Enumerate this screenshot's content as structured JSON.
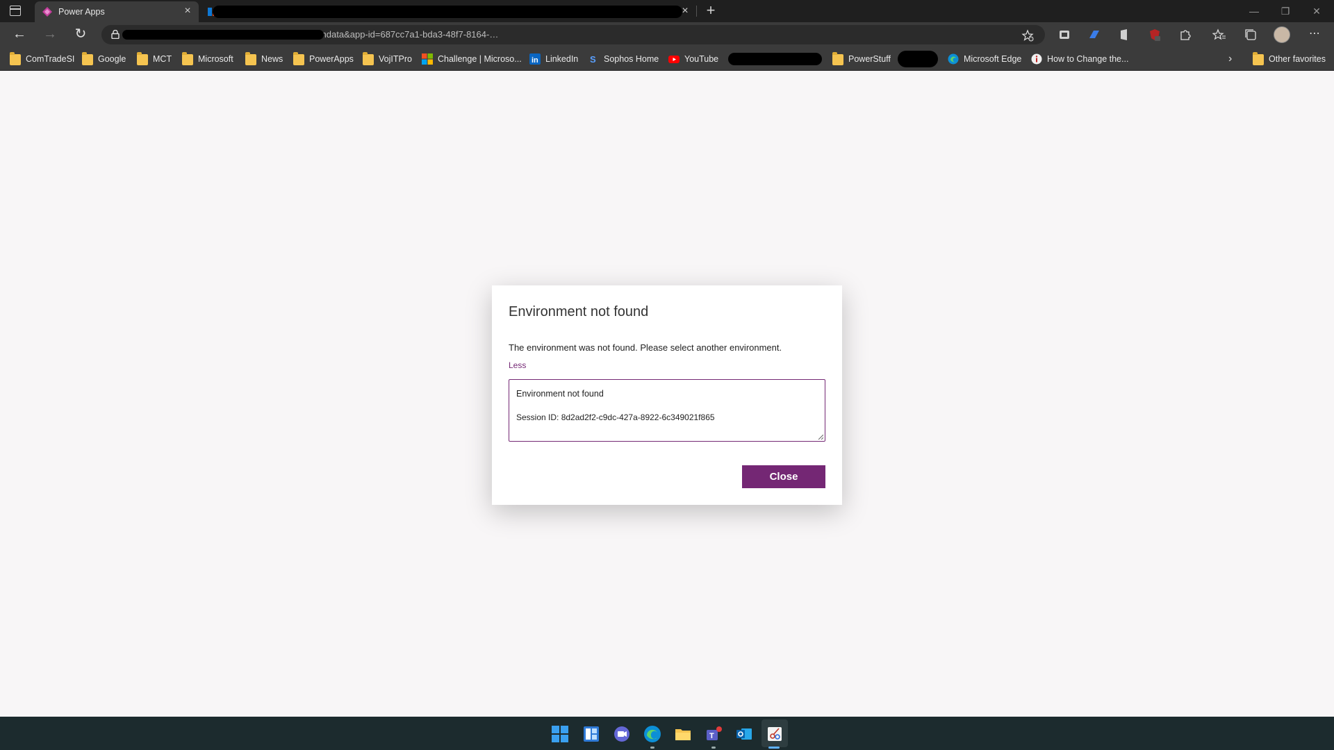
{
  "browser": {
    "tabs": [
      {
        "title": "Power Apps",
        "active": true
      },
      {
        "title": "",
        "active": false
      }
    ],
    "url": "…/studio/#action=sp-edit-formdata&app-id=687cc7a1-bda3-48f7-8164-…",
    "favorites": [
      {
        "label": "ComTradeSI",
        "icon": "folder-icon"
      },
      {
        "label": "Google",
        "icon": "folder-icon"
      },
      {
        "label": "MCT",
        "icon": "folder-icon"
      },
      {
        "label": "Microsoft",
        "icon": "folder-icon"
      },
      {
        "label": "News",
        "icon": "folder-icon"
      },
      {
        "label": "PowerApps",
        "icon": "folder-icon"
      },
      {
        "label": "VojITPro",
        "icon": "folder-icon"
      },
      {
        "label": "Challenge | Microso...",
        "icon": "microsoft-logo-icon"
      },
      {
        "label": "LinkedIn",
        "icon": "linkedin-icon"
      },
      {
        "label": "Sophos Home",
        "icon": "sophos-icon"
      },
      {
        "label": "YouTube",
        "icon": "youtube-icon"
      },
      {
        "label": "PowerStuff",
        "icon": "folder-icon"
      },
      {
        "label": "Microsoft Edge",
        "icon": "edge-icon"
      },
      {
        "label": "How to Change the...",
        "icon": "info-icon"
      }
    ],
    "other_favorites": "Other favorites",
    "colors": {
      "accent": "#742774",
      "chrome_dark": "#3b3b3b",
      "tabbar": "#1f1f1f"
    }
  },
  "dialog": {
    "title": "Environment not found",
    "message": "The environment was not found. Please select another environment.",
    "toggle_label": "Less",
    "details_line1": "Environment not found",
    "details_line2": "Session ID: 8d2ad2f2-c9dc-427a-8922-6c349021f865",
    "close_label": "Close"
  },
  "taskbar": {
    "apps": [
      "start-icon",
      "widgets-icon",
      "chat-icon",
      "edge-icon",
      "file-explorer-icon",
      "teams-icon",
      "outlook-icon",
      "snipping-tool-icon"
    ]
  }
}
